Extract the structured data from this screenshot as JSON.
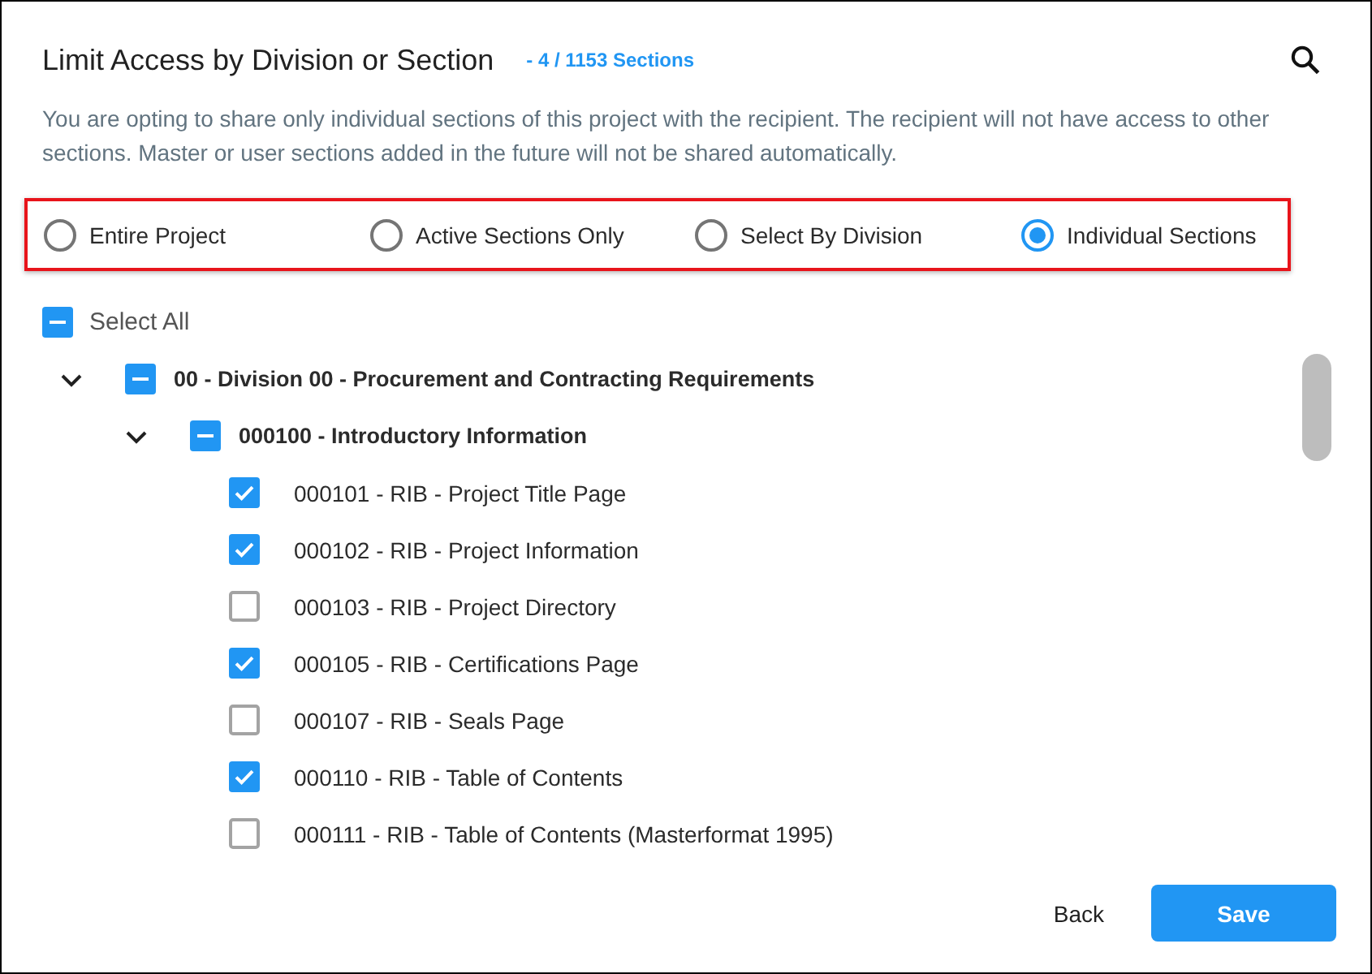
{
  "dialog": {
    "title": "Limit Access by Division or Section",
    "count": "- 4 / 1153 Sections",
    "description": "You are opting to share only individual sections of this project with the recipient. The recipient will not have access to other sections. Master or user sections added in the future will not be shared automatically."
  },
  "share_options": [
    {
      "label": "Entire Project",
      "selected": false
    },
    {
      "label": "Active Sections Only",
      "selected": false
    },
    {
      "label": "Select By Division",
      "selected": false
    },
    {
      "label": "Individual Sections",
      "selected": true
    }
  ],
  "select_all": {
    "label": "Select All",
    "partial": true
  },
  "tree": [
    {
      "label": "00 - Division 00 - Procurement and Contracting Requirements",
      "expanded": true,
      "partial": true,
      "children": [
        {
          "label": "000100 - Introductory Information",
          "expanded": true,
          "partial": true,
          "children": [
            {
              "label": "000101 - RIB - Project Title Page",
              "checked": true,
              "partial": false
            },
            {
              "label": "000102 - RIB - Project Information",
              "checked": true,
              "partial": false
            },
            {
              "label": "000103 - RIB - Project Directory",
              "checked": false,
              "partial": false
            },
            {
              "label": "000105 - RIB - Certifications Page",
              "checked": true,
              "partial": false
            },
            {
              "label": "000107 - RIB - Seals Page",
              "checked": false,
              "partial": false
            },
            {
              "label": "000110 - RIB - Table of Contents",
              "checked": true,
              "partial": false
            },
            {
              "label": "000111 - RIB - Table of Contents (Masterformat 1995)",
              "checked": false,
              "partial": false
            }
          ]
        }
      ]
    }
  ],
  "buttons": [
    {
      "label": "Back",
      "kind": "text"
    },
    {
      "label": "Save",
      "kind": "primary"
    }
  ]
}
